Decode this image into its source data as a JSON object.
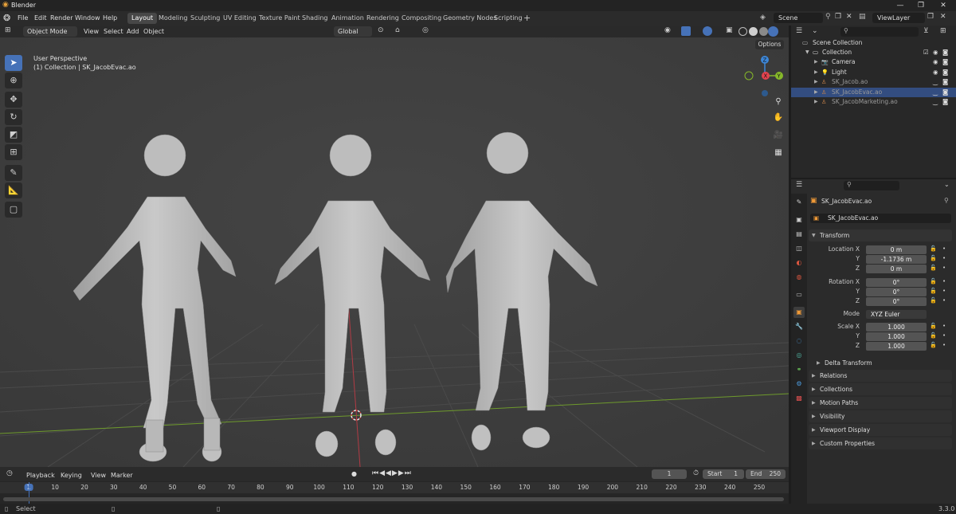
{
  "window": {
    "title": "Blender",
    "minimize": "—",
    "maximize": "❐",
    "close": "✕"
  },
  "menu": [
    "File",
    "Edit",
    "Render",
    "Window",
    "Help"
  ],
  "workspaces": [
    "Layout",
    "Modeling",
    "Sculpting",
    "UV Editing",
    "Texture Paint",
    "Shading",
    "Animation",
    "Rendering",
    "Compositing",
    "Geometry Nodes",
    "Scripting"
  ],
  "workspace_add": "+",
  "scene": {
    "label": "Scene",
    "viewlayer": "ViewLayer"
  },
  "viewport_header": {
    "mode": "Object Mode",
    "menus": [
      "View",
      "Select",
      "Add",
      "Object"
    ],
    "orientation": "Global",
    "options": "Options"
  },
  "viewport": {
    "perspective": "User Perspective",
    "collection_info": "(1) Collection | SK_JacobEvac.ao",
    "gizmo": {
      "x": "X",
      "y": "Y",
      "z": "Z"
    }
  },
  "timeline": {
    "menus": [
      "Playback",
      "Keying",
      "View",
      "Marker"
    ],
    "current_frame": "1",
    "start_label": "Start",
    "start": "1",
    "end_label": "End",
    "end": "250",
    "ruler": [
      "1",
      "10",
      "20",
      "30",
      "40",
      "50",
      "60",
      "70",
      "80",
      "90",
      "100",
      "110",
      "120",
      "130",
      "140",
      "150",
      "160",
      "170",
      "180",
      "190",
      "200",
      "210",
      "220",
      "230",
      "240",
      "250"
    ]
  },
  "status": {
    "left": "Select",
    "version": "3.3.0"
  },
  "outliner": {
    "root": "Scene Collection",
    "collection": "Collection",
    "items": [
      {
        "name": "Camera",
        "selected": false,
        "dim": false
      },
      {
        "name": "Light",
        "selected": false,
        "dim": false
      },
      {
        "name": "SK_Jacob.ao",
        "selected": false,
        "dim": true
      },
      {
        "name": "SK_JacobEvac.ao",
        "selected": true,
        "dim": true
      },
      {
        "name": "SK_JacobMarketing.ao",
        "selected": false,
        "dim": true
      }
    ]
  },
  "properties": {
    "object_name": "SK_JacobEvac.ao",
    "object_field": "SK_JacobEvac.ao",
    "transform_title": "Transform",
    "location_label": "Location X",
    "location": [
      "0 m",
      "-1.1736 m",
      "0 m"
    ],
    "rotation_label": "Rotation X",
    "rotation": [
      "0°",
      "0°",
      "0°"
    ],
    "mode_label": "Mode",
    "mode": "XYZ Euler",
    "scale_label": "Scale X",
    "scale": [
      "1.000",
      "1.000",
      "1.000"
    ],
    "y_label": "Y",
    "z_label": "Z",
    "delta": "Delta Transform",
    "panels": [
      "Relations",
      "Collections",
      "Motion Paths",
      "Visibility",
      "Viewport Display",
      "Custom Properties"
    ]
  },
  "colors": {
    "accent": "#4672b8",
    "x_axis": "#e3434f",
    "y_axis": "#86b82a",
    "z_axis": "#3d87d8",
    "selection": "#334d80"
  }
}
